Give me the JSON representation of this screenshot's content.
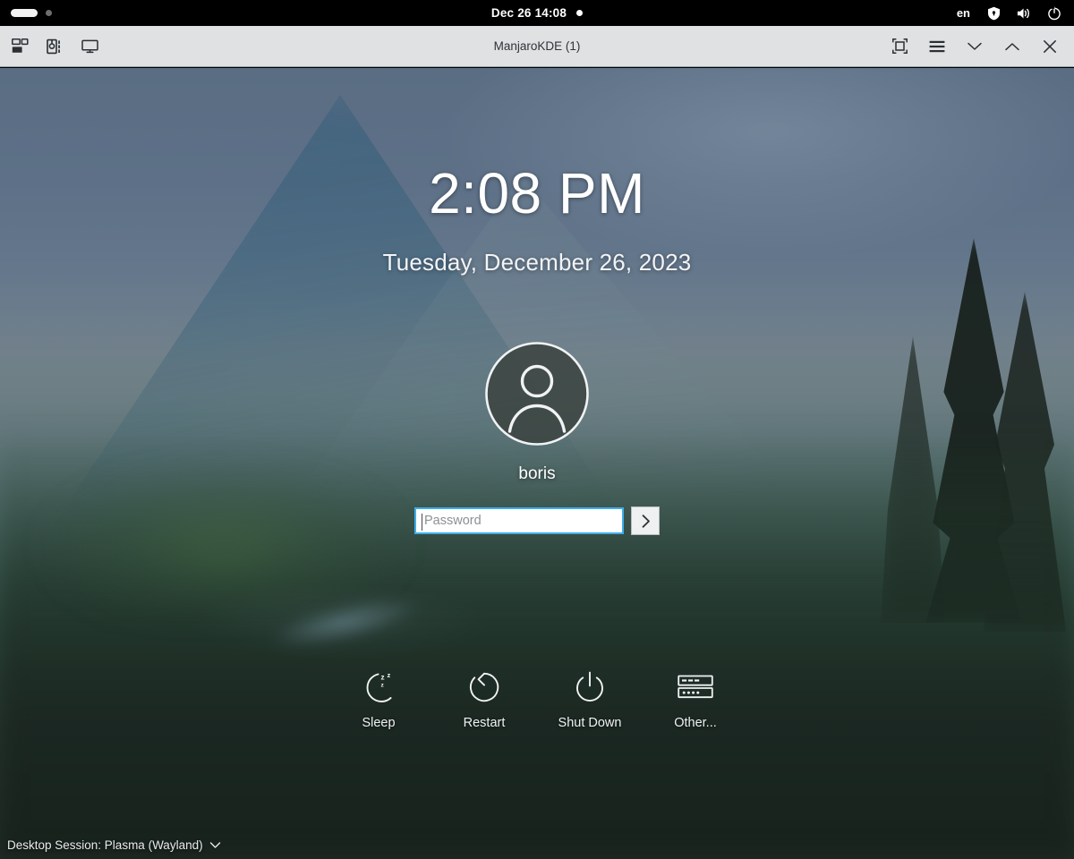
{
  "statusbar": {
    "clock": "Dec 26  14:08",
    "language": "en",
    "icons": {
      "home_pill": "home-indicator",
      "status_dot": "status-dot",
      "recording_dot": "recording-dot",
      "shield": "shield-icon",
      "volume": "volume-icon",
      "power": "power-icon"
    }
  },
  "titlebar": {
    "title": "ManjaroKDE (1)",
    "left_icons": {
      "workspaces": "workspaces-icon",
      "devices": "devices-icon",
      "display": "display-icon"
    },
    "controls": {
      "fullscreen": "fullscreen-icon",
      "menu": "hamburger-menu-icon",
      "minimize": "chevron-down-icon",
      "maximize": "chevron-up-icon",
      "close": "close-icon"
    }
  },
  "lockscreen": {
    "time": "2:08 PM",
    "date": "Tuesday, December 26, 2023",
    "username": "boris",
    "avatar_icon": "user-avatar-icon",
    "password": {
      "value": "",
      "placeholder": "Password",
      "submit_icon": "chevron-right-icon"
    },
    "actions": [
      {
        "label": "Sleep",
        "icon": "sleep-moon-icon"
      },
      {
        "label": "Restart",
        "icon": "restart-icon"
      },
      {
        "label": "Shut Down",
        "icon": "shutdown-power-icon"
      },
      {
        "label": "Other...",
        "icon": "other-sessions-icon"
      }
    ],
    "session": {
      "label": "Desktop Session: Plasma (Wayland)",
      "chevron_icon": "chevron-down-icon"
    }
  },
  "colors": {
    "statusbar_bg": "#000000",
    "titlebar_bg": "#dfe1e3",
    "focus_blue": "#3daee9",
    "sky": "#5a6d83",
    "ground": "#202b25",
    "text_light": "#ffffff"
  }
}
